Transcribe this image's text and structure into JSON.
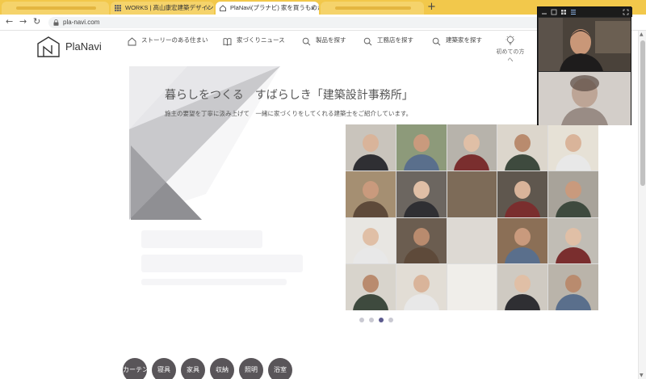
{
  "browser": {
    "tabs": [
      {
        "label": "",
        "blurred": true
      },
      {
        "label": "WORKS | 高山康宏建築デザイン",
        "blurred": false
      },
      {
        "label": "PlaNavi(プラナビ) 家を買うものから…",
        "blurred": false
      },
      {
        "label": "",
        "blurred": true
      }
    ],
    "url": "pla-navi.com"
  },
  "site": {
    "logo": "PlaNavi",
    "nav": [
      {
        "label": "ストーリーのある住まい",
        "icon": "house-icon"
      },
      {
        "label": "家づくりニュース",
        "icon": "book-icon"
      },
      {
        "label": "製品を探す",
        "icon": "search-icon"
      },
      {
        "label": "工務店を探す",
        "icon": "search-icon"
      },
      {
        "label": "建築家を探す",
        "icon": "search-icon"
      }
    ],
    "beginner_label": "初めての方へ"
  },
  "hero": {
    "title": "暮らしをつくる　すばらしき「建築設計事務所」",
    "subtitle": "施主の要望を丁寧に汲み上げて　一緒に家づくりをしてくれる建築士をご紹介しています。",
    "active_slide": 2,
    "slide_count": 4
  },
  "categories": [
    "カーテン",
    "寝具",
    "家具",
    "収納",
    "照明",
    "浴室"
  ],
  "colors": {
    "chrome_yellow": "#f2c84b",
    "accent_purple": "#5b5a8e",
    "category_bg": "#595559"
  }
}
